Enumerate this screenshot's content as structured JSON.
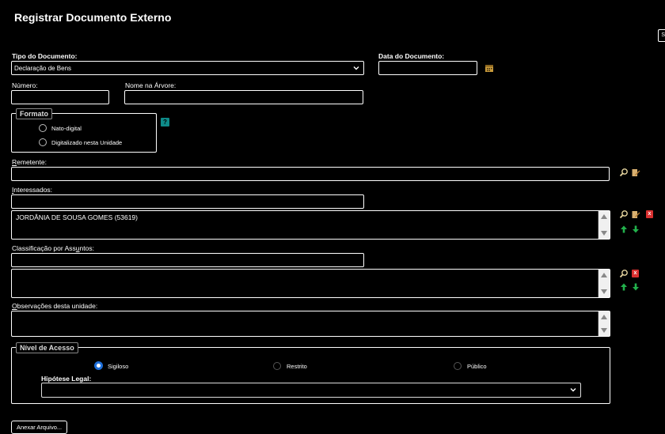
{
  "page": {
    "title": "Registrar Documento Externo",
    "side_button": "S"
  },
  "tipo_documento": {
    "label": "Tipo do Documento:",
    "value": "Declaração de Bens"
  },
  "data_documento": {
    "label": "Data do Documento:",
    "value": ""
  },
  "numero": {
    "label": "Número:",
    "value": ""
  },
  "nome_arvore": {
    "label": "Nome na Árvore:",
    "value": ""
  },
  "formato": {
    "legend": "Formato",
    "options": [
      "Nato-digital",
      "Digitalizado nesta Unidade"
    ],
    "help": "?"
  },
  "remetente": {
    "label_u": "R",
    "label_rest": "emetente:",
    "value": ""
  },
  "interessados": {
    "label_u": "I",
    "label_rest": "nteressados:",
    "items": [
      "JORDÂNIA DE SOUSA GOMES (53619)"
    ]
  },
  "classificacao": {
    "label_pre": "Classificação por Ass",
    "label_u": "u",
    "label_post": "ntos:"
  },
  "observacoes": {
    "label_u": "O",
    "label_rest": "bservações desta unidade:"
  },
  "nivel_acesso": {
    "legend": "Nível de Acesso",
    "options": [
      "Sigiloso",
      "Restrito",
      "Público"
    ],
    "selected": "Sigiloso",
    "hipotese_label": "Hipótese Legal:",
    "hipotese_value": ""
  },
  "anexar": {
    "label": "Anexar Arquivo..."
  },
  "icons": {
    "search": "search-icon",
    "edit": "edit-icon",
    "remove": "remove-icon",
    "up": "arrow-up-icon",
    "down": "arrow-down-icon",
    "calendar": "calendar-icon"
  },
  "colors": {
    "background": "#000000",
    "accent_blue": "#1e6fd9",
    "remove_red": "#d93030",
    "arrow_green": "#22b14c",
    "help_teal": "#0e8a88"
  }
}
